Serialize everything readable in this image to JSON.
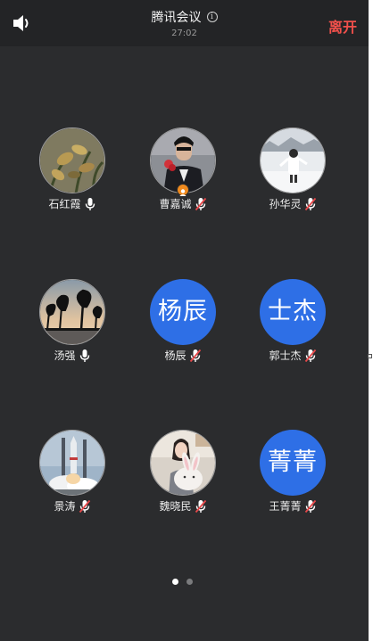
{
  "header": {
    "title": "腾讯会议",
    "timer": "27:02",
    "leave_label": "离开"
  },
  "participants": [
    {
      "name": "石红霞",
      "avatar_type": "photo-flowers",
      "mic": "on"
    },
    {
      "name": "曹嘉诚",
      "avatar_type": "photo-man-suit",
      "mic": "muted",
      "host": true
    },
    {
      "name": "孙华灵",
      "avatar_type": "photo-snow",
      "mic": "muted"
    },
    {
      "name": "汤强",
      "avatar_type": "photo-sunset-trees",
      "mic": "on"
    },
    {
      "name": "杨辰",
      "avatar_type": "text",
      "avatar_text": "杨辰",
      "mic": "muted"
    },
    {
      "name": "郭士杰",
      "avatar_type": "text",
      "avatar_text": "士杰",
      "mic": "muted"
    },
    {
      "name": "景涛",
      "avatar_type": "photo-rocket",
      "mic": "muted"
    },
    {
      "name": "魏晓民",
      "avatar_type": "photo-girl-bunny",
      "mic": "muted"
    },
    {
      "name": "王菁菁",
      "avatar_type": "text",
      "avatar_text": "菁菁",
      "mic": "muted"
    }
  ],
  "pagination": {
    "pages": 2,
    "current": 1
  },
  "colors": {
    "background": "#2b2c2e",
    "topbar": "#232426",
    "leave": "#f0504b",
    "text_avatar": "#2e6fe6",
    "host_badge": "#f08a1e",
    "muted_slash": "#e8484a"
  },
  "icons": {
    "speaker": "speaker-icon",
    "info": "info-icon",
    "mic_on": "mic-icon",
    "mic_muted": "mic-muted-icon",
    "host": "host-badge-icon"
  }
}
